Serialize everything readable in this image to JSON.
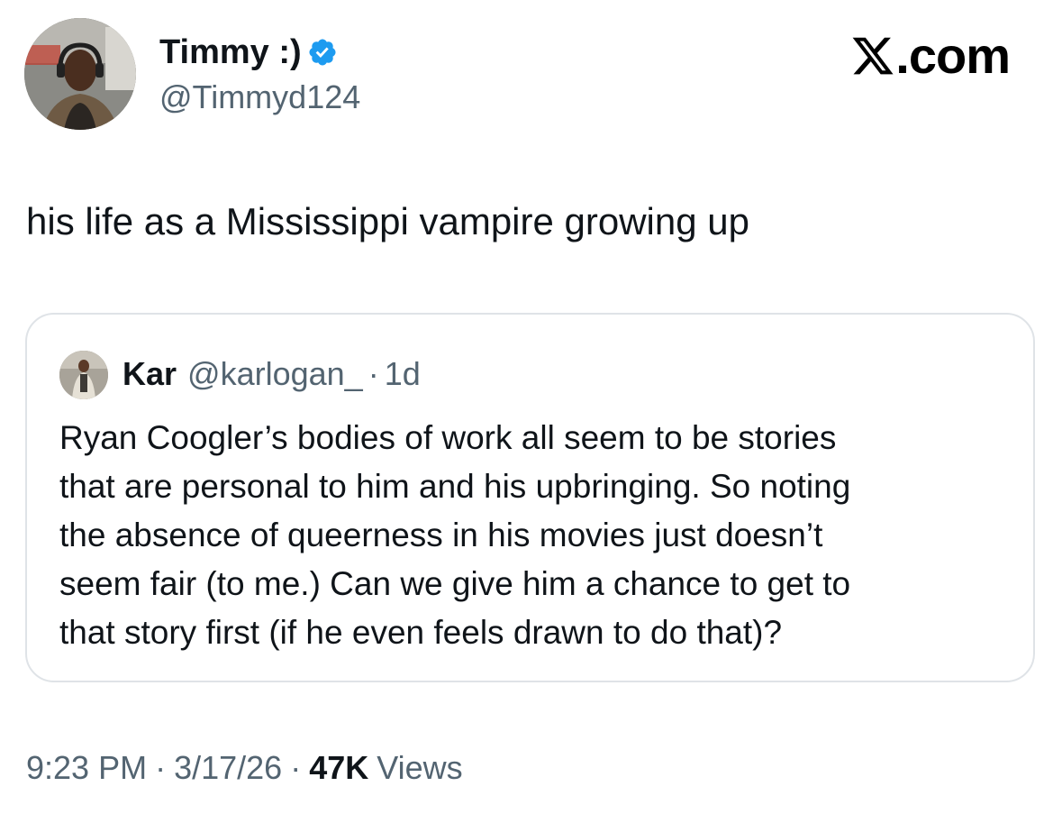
{
  "author": {
    "display_name": "Timmy :)",
    "handle": "@Timmyd124",
    "verified": true,
    "verified_icon": "verified-badge-icon",
    "verified_color": "#1d9bf0",
    "avatar": "profile-photo"
  },
  "brand": {
    "icon": "x-logo-icon",
    "text": ".com"
  },
  "tweet": {
    "text": "his life as a Mississippi vampire growing up"
  },
  "quote": {
    "avatar": "profile-photo",
    "display_name": "Kar",
    "handle": "@karlogan_",
    "separator": "·",
    "time": "1d",
    "lines": [
      "Ryan Coogler’s bodies of work all seem to be stories",
      "that are personal to him and his upbringing. So noting",
      "the absence of queerness in his movies just doesn’t",
      "seem fair (to me.) Can we give him a chance to get to",
      "that story first (if he even feels drawn to do that)?"
    ]
  },
  "meta": {
    "time": "9:23 PM",
    "separator": "·",
    "date": "3/17/26",
    "views_count": "47K",
    "views_label": "Views"
  },
  "colors": {
    "text": "#0f1419",
    "secondary": "#536471",
    "border": "#dfe3e7",
    "accent": "#1d9bf0"
  }
}
